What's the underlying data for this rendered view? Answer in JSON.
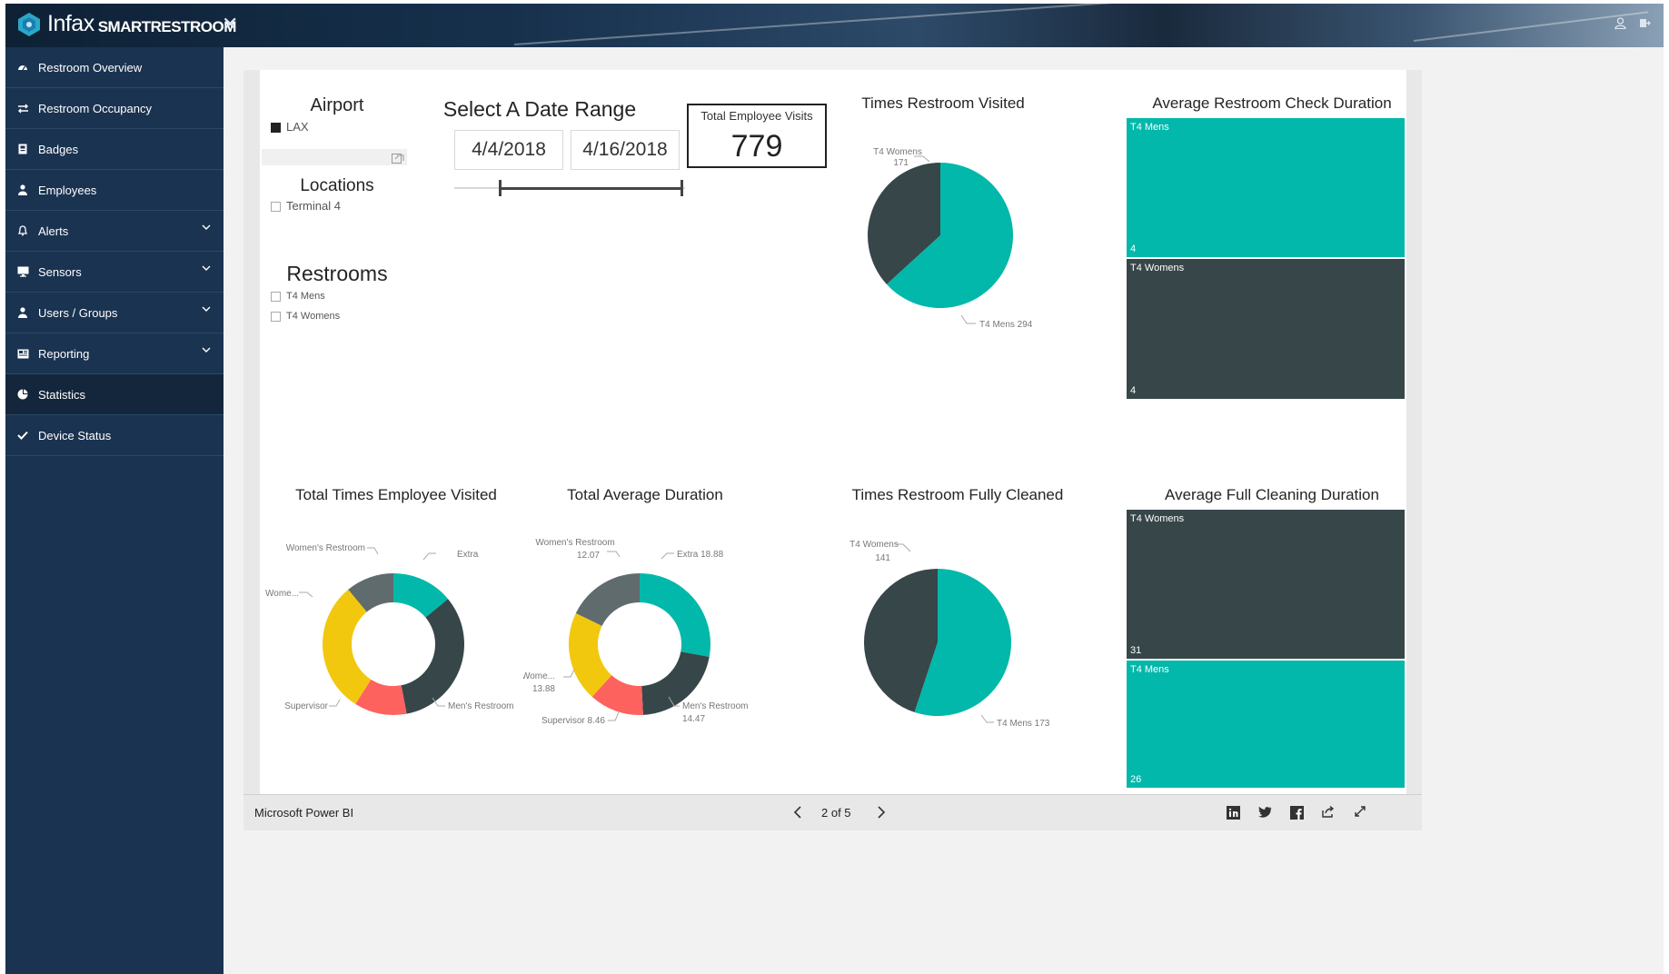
{
  "app": {
    "brand": "Infax",
    "product": "SMARTRESTROOM"
  },
  "colors": {
    "teal": "#01b8aa",
    "dark": "#374649",
    "gray": "#5f6b6d",
    "yellow": "#f2c80f",
    "red": "#fd625e",
    "sidebar": "#1a3350"
  },
  "sidebar": {
    "items": [
      {
        "label": "Restroom Overview",
        "icon": "dashboard-icon",
        "chevron": false
      },
      {
        "label": "Restroom Occupancy",
        "icon": "arrows-icon",
        "chevron": false
      },
      {
        "label": "Badges",
        "icon": "badge-icon",
        "chevron": false
      },
      {
        "label": "Employees",
        "icon": "user-icon",
        "chevron": false
      },
      {
        "label": "Alerts",
        "icon": "bell-icon",
        "chevron": true
      },
      {
        "label": "Sensors",
        "icon": "monitor-icon",
        "chevron": true
      },
      {
        "label": "Users / Groups",
        "icon": "users-icon",
        "chevron": true
      },
      {
        "label": "Reporting",
        "icon": "report-icon",
        "chevron": true
      },
      {
        "label": "Statistics",
        "icon": "piechart-icon",
        "chevron": false,
        "active": true
      },
      {
        "label": "Device Status",
        "icon": "check-icon",
        "chevron": false
      }
    ]
  },
  "slicers": {
    "airport": {
      "title": "Airport",
      "items": [
        "LAX"
      ]
    },
    "locations": {
      "title": "Locations",
      "items": [
        "Terminal 4"
      ]
    },
    "restrooms": {
      "title": "Restrooms",
      "items": [
        "T4 Mens",
        "T4 Womens"
      ]
    },
    "date": {
      "title": "Select A Date Range",
      "start": "4/4/2018",
      "end": "4/16/2018"
    }
  },
  "kpi": {
    "label": "Total Employee Visits",
    "value": "779"
  },
  "charts": {
    "visited": {
      "title": "Times Restroom Visited",
      "labels": [
        "T4 Womens",
        "171",
        "T4 Mens 294"
      ]
    },
    "check_duration": {
      "title": "Average Restroom Check Duration",
      "cells": [
        {
          "label": "T4 Mens",
          "value": "4"
        },
        {
          "label": "T4 Womens",
          "value": "4"
        }
      ]
    },
    "employee_visited": {
      "title": "Total Times Employee Visited",
      "labels": [
        "Women's Restroom",
        "Extra",
        "Wome...",
        "Supervisor",
        "Men's Restroom"
      ]
    },
    "avg_duration": {
      "title": "Total Average Duration",
      "labels": [
        "Women's Restroom",
        "12.07",
        "Extra 18.88",
        "Wome...",
        "13.88",
        "Supervisor 8.46",
        "Men's Restroom",
        "14.47"
      ]
    },
    "cleaned": {
      "title": "Times Restroom Fully Cleaned",
      "labels": [
        "T4 Womens",
        "141",
        "T4 Mens 173"
      ]
    },
    "cleaning_duration": {
      "title": "Average Full Cleaning Duration",
      "cells": [
        {
          "label": "T4 Womens",
          "value": "31"
        },
        {
          "label": "T4 Mens",
          "value": "26"
        }
      ]
    }
  },
  "chart_data": [
    {
      "type": "pie",
      "title": "Times Restroom Visited",
      "categories": [
        "T4 Mens",
        "T4 Womens"
      ],
      "values": [
        294,
        171
      ]
    },
    {
      "type": "treemap",
      "title": "Average Restroom Check Duration",
      "categories": [
        "T4 Mens",
        "T4 Womens"
      ],
      "values": [
        4,
        4
      ]
    },
    {
      "type": "pie",
      "title": "Total Times Employee Visited",
      "donut": true,
      "categories": [
        "Extra",
        "Men's Restroom",
        "Supervisor",
        "Wome...",
        "Women's Restroom"
      ],
      "values": [
        14,
        33,
        12,
        30,
        11
      ]
    },
    {
      "type": "pie",
      "title": "Total Average Duration",
      "donut": true,
      "categories": [
        "Extra",
        "Men's Restroom",
        "Supervisor",
        "Wome...",
        "Women's Restroom"
      ],
      "values": [
        18.88,
        14.47,
        8.46,
        13.88,
        12.07
      ]
    },
    {
      "type": "pie",
      "title": "Times Restroom Fully Cleaned",
      "categories": [
        "T4 Mens",
        "T4 Womens"
      ],
      "values": [
        173,
        141
      ]
    },
    {
      "type": "treemap",
      "title": "Average Full Cleaning Duration",
      "categories": [
        "T4 Womens",
        "T4 Mens"
      ],
      "values": [
        31,
        26
      ]
    }
  ],
  "footer": {
    "brand": "Microsoft Power BI",
    "page": "2 of 5"
  }
}
